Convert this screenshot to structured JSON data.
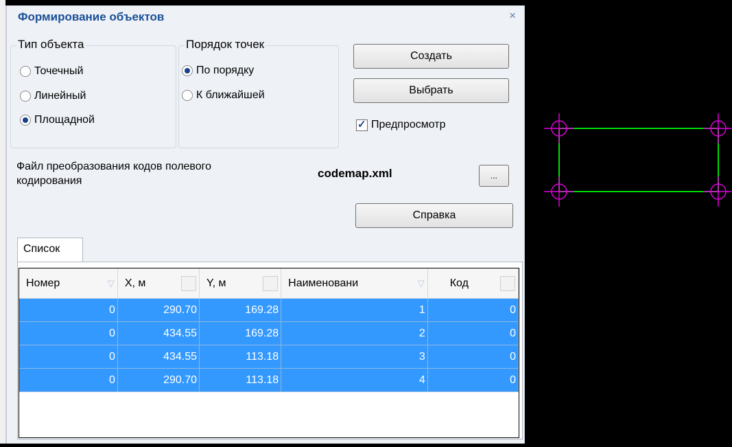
{
  "dialog": {
    "title": "Формирование объектов",
    "close": "×",
    "object_type": {
      "legend": "Тип объекта",
      "options": [
        "Точечный",
        "Линейный",
        "Площадной"
      ],
      "selected": "Площадной"
    },
    "point_order": {
      "legend": "Порядок точек",
      "options": [
        "По порядку",
        "К ближайшей"
      ],
      "selected": "По порядку"
    },
    "buttons": {
      "create": "Создать",
      "select": "Выбрать",
      "browse": "...",
      "help": "Справка"
    },
    "preview": {
      "label": "Предпросмотр",
      "checked": true
    },
    "codemap_label": [
      "Файл преобразования кодов полевого",
      "кодирования"
    ],
    "codemap_file": "codemap.xml",
    "tab": "Список",
    "table": {
      "columns": [
        "Номер",
        "X, м",
        "Y, м",
        "Наименовани",
        "Код"
      ],
      "rows": [
        [
          "0",
          "290.70",
          "169.28",
          "1",
          "0"
        ],
        [
          "0",
          "434.55",
          "169.28",
          "2",
          "0"
        ],
        [
          "0",
          "434.55",
          "113.18",
          "3",
          "0"
        ],
        [
          "0",
          "290.70",
          "113.18",
          "4",
          "0"
        ]
      ]
    }
  },
  "colors": {
    "selection": "#3399ff",
    "title": "#1a4f97",
    "cad_line": "#00e000",
    "cad_marker": "#e000e0"
  }
}
